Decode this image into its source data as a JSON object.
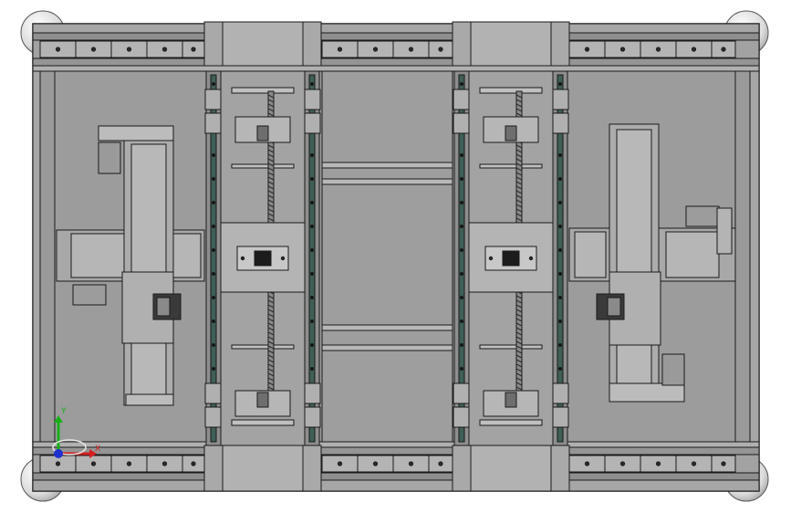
{
  "viewport": {
    "background_color": "#ffffff",
    "model_fill": "#9c9c9c",
    "model_fill_light": "#b4b4b4",
    "edge_color": "#1a1a1a",
    "rail_color": "#3f5f57",
    "foot_color": "#e8e8e8"
  },
  "triad": {
    "x_label": "X",
    "y_label": "Y",
    "x_color": "#d42020",
    "y_color": "#18b018",
    "z_color": "#2030d0"
  }
}
